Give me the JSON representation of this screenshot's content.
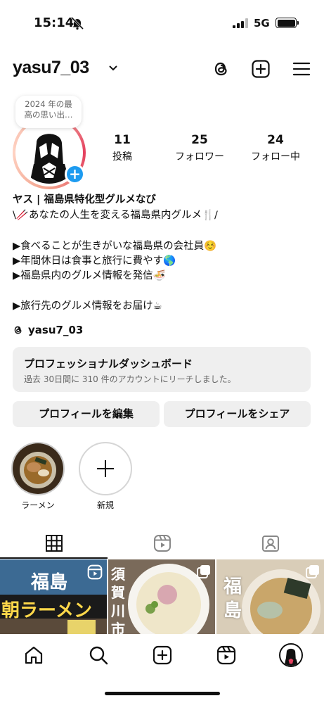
{
  "status": {
    "time": "15:14",
    "network": "5G"
  },
  "header": {
    "username": "yasu7_03"
  },
  "profile": {
    "note": "2024 年の最高の思い出…",
    "stats": [
      {
        "count": "11",
        "label": "投稿"
      },
      {
        "count": "25",
        "label": "フォロワー"
      },
      {
        "count": "24",
        "label": "フォロー中"
      }
    ]
  },
  "bio": {
    "name": "ヤス | 福島県特化型グルメなび",
    "lines": [
      "\\🥢あなたの人生を変える福島県内グルメ🍴/",
      "▶食べることが生きがいな福島県の会社員☺️",
      "▶年間休日は食事と旅行に費やす🌎",
      "▶福島県内のグルメ情報を発信🍜",
      "▶旅行先のグルメ情報をお届け☕"
    ],
    "threads_handle": "yasu7_03"
  },
  "dashboard": {
    "title": "プロフェッショナルダッシュボード",
    "subtitle": "過去 30日間に 310 件のアカウントにリーチしました。"
  },
  "actions": {
    "edit_label": "プロフィールを編集",
    "share_label": "プロフィールをシェア"
  },
  "highlights": [
    {
      "label": "ラーメン"
    },
    {
      "label": "新規"
    }
  ],
  "posts": [
    {
      "line1": "福島",
      "line2": "朝ラーメン"
    },
    {
      "text": "須賀川市"
    },
    {
      "text": "福島"
    }
  ],
  "colors": {
    "accent": "#1d9bf0",
    "button_bg": "#efefef"
  }
}
